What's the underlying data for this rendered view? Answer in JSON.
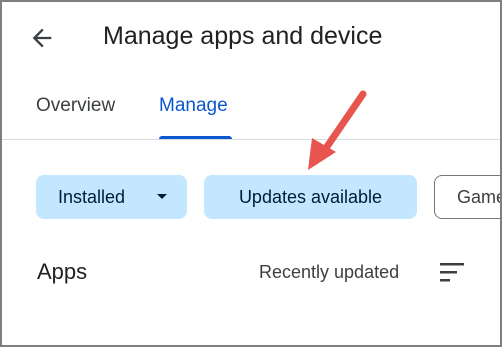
{
  "header": {
    "title": "Manage apps and device",
    "back_icon": "arrow-back-icon"
  },
  "tabs": [
    {
      "label": "Overview",
      "selected": false
    },
    {
      "label": "Manage",
      "selected": true
    }
  ],
  "filters": {
    "installed_label": "Installed",
    "updates_label": "Updates available",
    "games_label": "Games"
  },
  "apps_section": {
    "title": "Apps",
    "sort_label": "Recently updated",
    "sort_icon": "sort-icon"
  },
  "colors": {
    "accent": "#0b57d0",
    "chip_selected": "#c2e7ff",
    "annotation_arrow": "#e8554e"
  }
}
